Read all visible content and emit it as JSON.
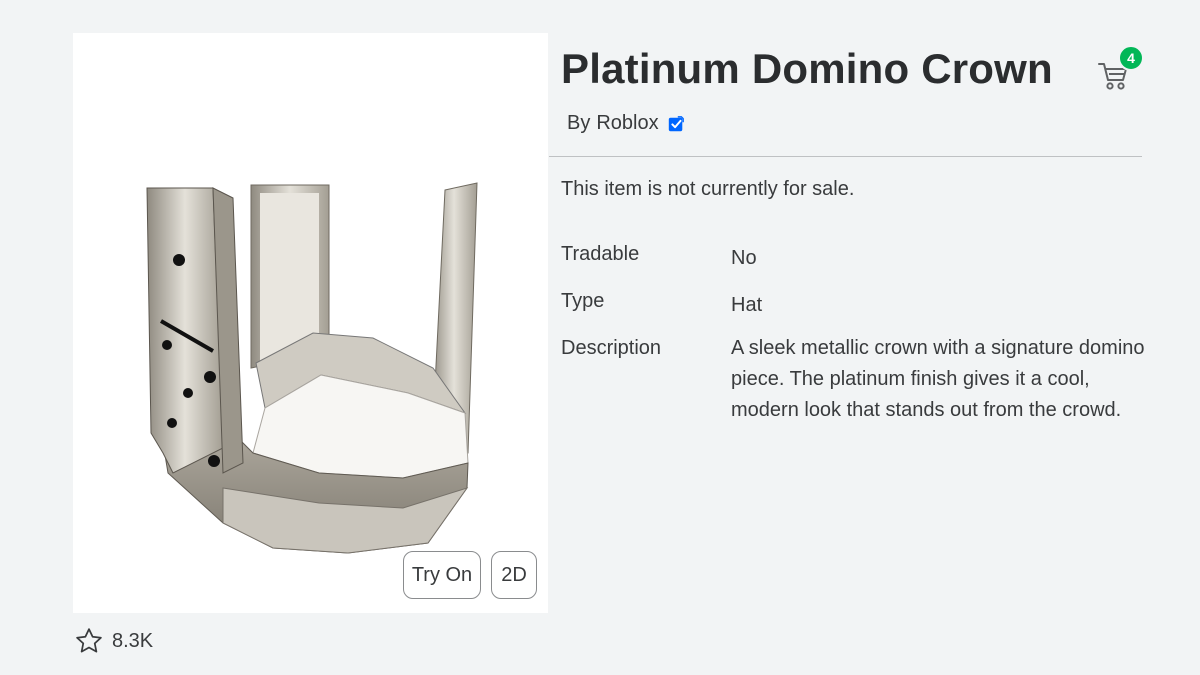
{
  "item": {
    "title": "Platinum Domino Crown",
    "by_prefix": "By",
    "creator": "Roblox",
    "sale_status": "This item is not currently for sale.",
    "details": {
      "tradable_label": "Tradable",
      "tradable_value": "No",
      "type_label": "Type",
      "type_value": "Hat",
      "description_label": "Description",
      "description_value": "A sleek metallic crown with a signature domino piece. The platinum finish gives it a cool, modern look that stands out from the crowd."
    }
  },
  "thumbnail": {
    "try_on_label": "Try On",
    "view_2d_label": "2D"
  },
  "favorites": {
    "count": "8.3K",
    "icon": "star-outline-icon"
  },
  "cart": {
    "icon": "shopping-cart-icon",
    "badge_count": "4"
  },
  "colors": {
    "background": "#f2f4f5",
    "panel": "#ffffff",
    "badge_green": "#02b757",
    "verified_blue": "#0066ff"
  }
}
